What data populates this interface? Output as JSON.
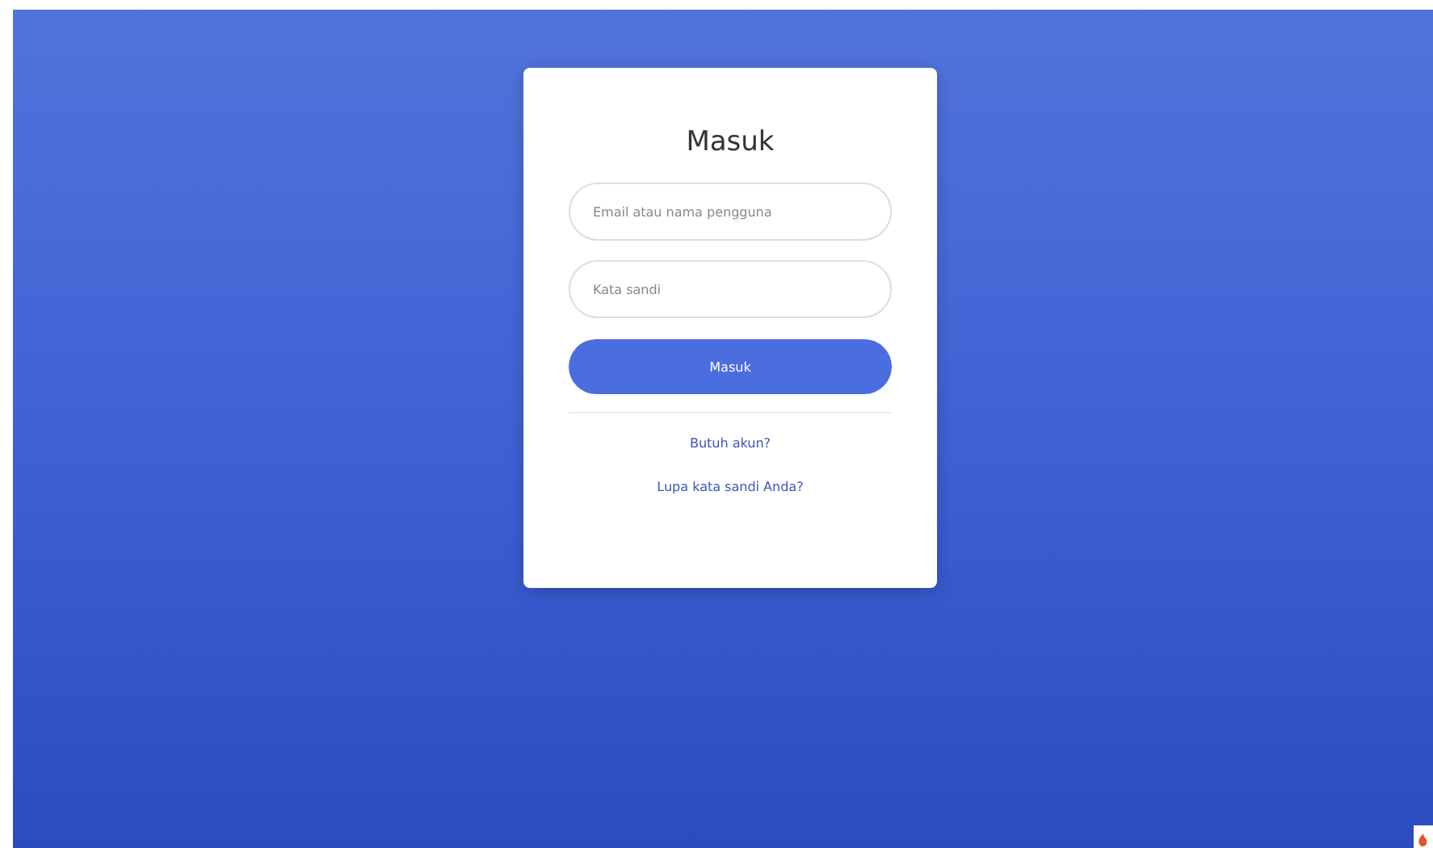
{
  "login_card": {
    "title": "Masuk",
    "fields": [
      {
        "placeholder": "Email atau nama pengguna"
      },
      {
        "placeholder": "Kata sandi"
      }
    ],
    "submit_button": "Masuk",
    "links": [
      "Butuh akun?",
      "Lupa kata sandi Anda?"
    ]
  }
}
